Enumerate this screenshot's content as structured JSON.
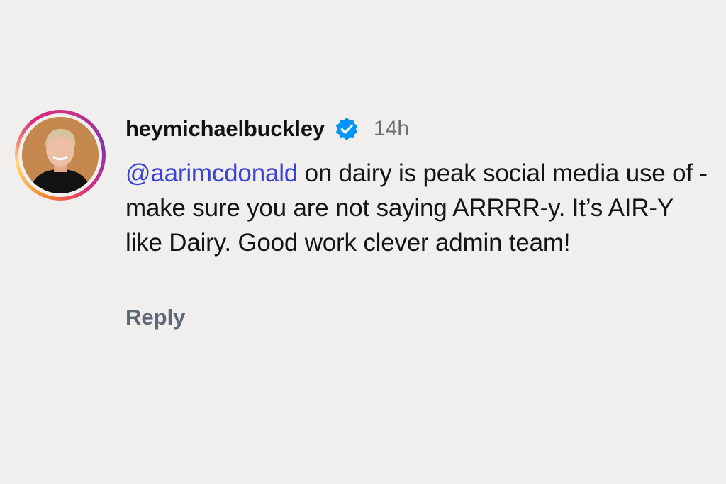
{
  "comment": {
    "username": "heymichaelbuckley",
    "timestamp": "14h",
    "mention_glyph": "@",
    "mention": "aarimcdonald",
    "body": " on dairy is peak social media use of - make sure you are not saying ARRRR-y. It’s AIR-Y like Dairy. Good work clever admin team!",
    "reply_label": "Reply",
    "verified": true
  },
  "icons": {
    "avatar": "profile-photo",
    "verified": "verified-badge-icon",
    "mention": "threads-icon"
  },
  "colors": {
    "background": "#f1efee",
    "username": "#121212",
    "mention": "#3b43d6",
    "verified": "#0095f6",
    "timestamp": "#6b6f75",
    "reply": "#5f6976"
  }
}
